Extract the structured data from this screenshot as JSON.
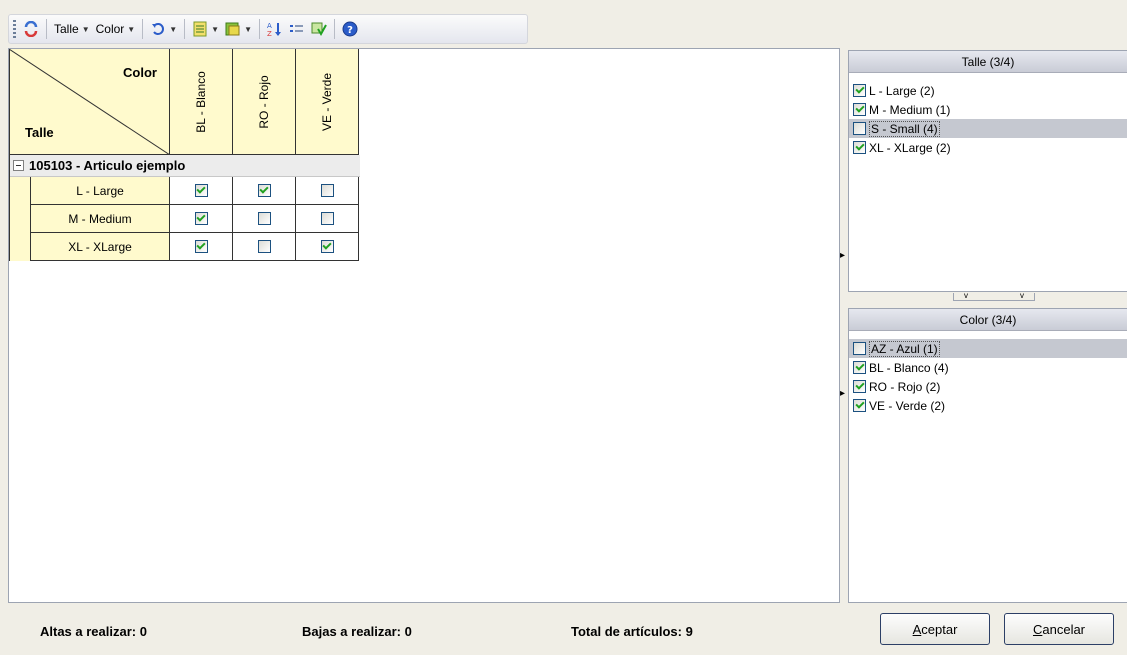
{
  "toolbar": {
    "talle_label": "Talle",
    "color_label": "Color",
    "icons": [
      "refresh-icon",
      "undo-icon",
      "list-view-icon",
      "export-icon",
      "sort-icon",
      "details-icon",
      "filter-icon",
      "help-icon"
    ]
  },
  "grid": {
    "corner_color_label": "Color",
    "corner_talle_label": "Talle",
    "columns": [
      "BL - Blanco",
      "RO - Rojo",
      "VE - Verde"
    ],
    "group_label": "105103 - Articulo ejemplo",
    "rows": [
      {
        "label": "L - Large",
        "values": [
          true,
          true,
          false
        ]
      },
      {
        "label": "M - Medium",
        "values": [
          true,
          false,
          false
        ]
      },
      {
        "label": "XL - XLarge",
        "values": [
          true,
          false,
          true
        ]
      }
    ]
  },
  "talle_panel": {
    "title": "Talle (3/4)",
    "items": [
      {
        "label": "L - Large (2)",
        "checked": true,
        "selected": false
      },
      {
        "label": "M - Medium (1)",
        "checked": true,
        "selected": false
      },
      {
        "label": "S - Small (4)",
        "checked": false,
        "selected": true
      },
      {
        "label": "XL - XLarge (2)",
        "checked": true,
        "selected": false
      }
    ]
  },
  "color_panel": {
    "title": "Color (3/4)",
    "items": [
      {
        "label": "AZ - Azul (1)",
        "checked": false,
        "selected": true
      },
      {
        "label": "BL - Blanco (4)",
        "checked": true,
        "selected": false
      },
      {
        "label": "RO - Rojo (2)",
        "checked": true,
        "selected": false
      },
      {
        "label": "VE - Verde (2)",
        "checked": true,
        "selected": false
      }
    ]
  },
  "status": {
    "altas": "Altas a realizar:  0",
    "bajas": "Bajas a realizar:  0",
    "total": "Total de artículos:   9"
  },
  "buttons": {
    "accept_mnemonic": "A",
    "accept_rest": "ceptar",
    "cancel_mnemonic": "C",
    "cancel_rest": "ancelar"
  },
  "colors": {
    "header_yellow": "#fffacd",
    "check_green": "#21a121",
    "selection_gray": "#c5c8d0"
  }
}
